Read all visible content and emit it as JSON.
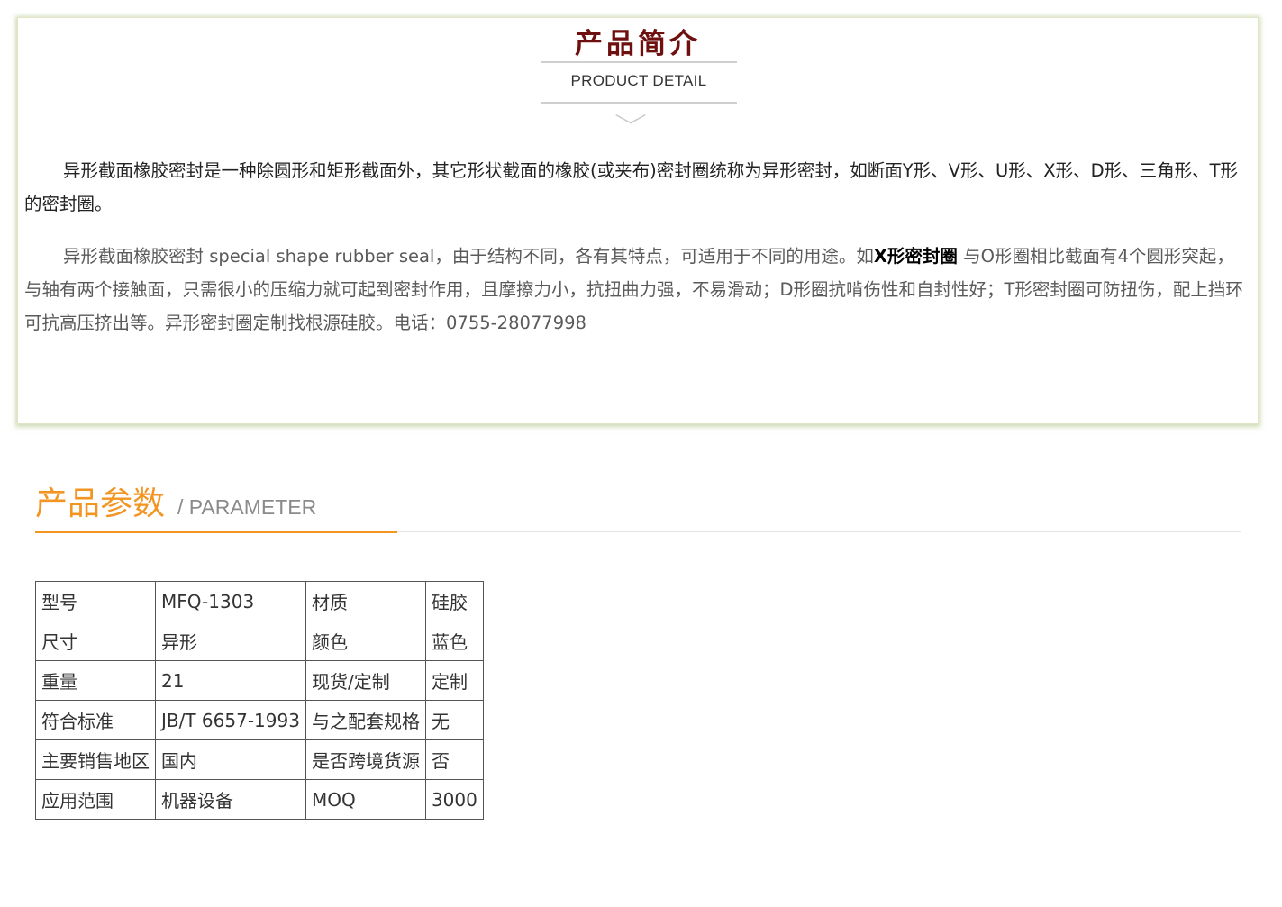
{
  "intro": {
    "title": "产品简介",
    "subtitle": "PRODUCT DETAIL",
    "para1": "异形截面橡胶密封是一种除圆形和矩形截面外，其它形状截面的橡胶(或夹布)密封圈统称为异形密封，如断面Y形、V形、U形、X形、D形、三角形、T形的密封圈。",
    "para2_before": "异形截面橡胶密封 special shape rubber seal，由于结构不同，各有其特点，可适用于不同的用途。如",
    "para2_bold": "X形密封圈",
    "para2_after": " 与O形圈相比截面有4个圆形突起，与轴有两个接触面，只需很小的压缩力就可起到密封作用，且摩擦力小，抗扭曲力强，不易滑动；D形圈抗啃伤性和自封性好；T形密封圈可防扭伤，配上挡环可抗高压挤出等。异形密封圈定制找根源硅胶。电话：0755-28077998"
  },
  "parameter": {
    "title_cn": "产品参数",
    "title_en": "/ PARAMETER",
    "rows": [
      [
        "型号",
        "MFQ-1303",
        "材质",
        "硅胶"
      ],
      [
        "尺寸",
        "异形",
        "颜色",
        "蓝色"
      ],
      [
        "重量",
        "21",
        "现货/定制",
        "定制"
      ],
      [
        "符合标准",
        "JB/T 6657-1993",
        "与之配套规格",
        "无"
      ],
      [
        "主要销售地区",
        "国内",
        "是否跨境货源",
        "否"
      ],
      [
        "应用范围",
        "机器设备",
        "MOQ",
        "3000"
      ]
    ]
  },
  "colors": {
    "title_red": "#6e1010",
    "accent_orange": "#f29522",
    "card_shadow_green": "#aabe78"
  }
}
